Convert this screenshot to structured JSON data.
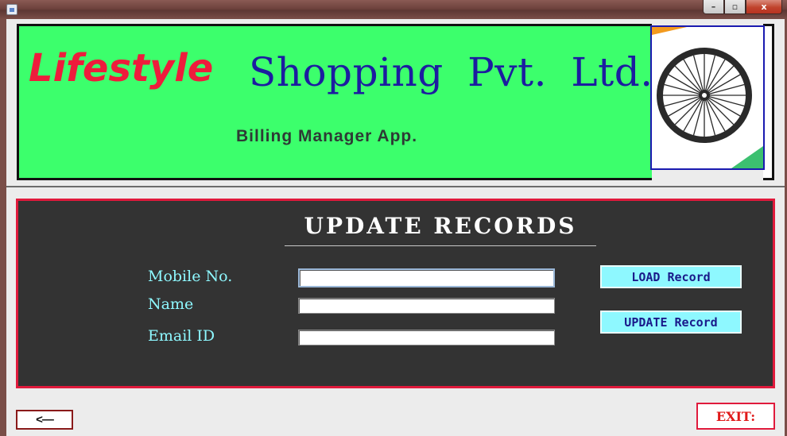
{
  "window": {
    "minimize_glyph": "–",
    "maximize_glyph": "▫",
    "close_glyph": "x"
  },
  "header": {
    "brand_word": "Lifestyle",
    "brand_rest": "Shopping Pvt. Ltd.",
    "subtitle": "Billing Manager App.",
    "logo_icon": "ashoka-chakra-icon"
  },
  "form": {
    "title": "UPDATE RECORDS",
    "fields": [
      {
        "label": "Mobile No.",
        "value": ""
      },
      {
        "label": "Name",
        "value": ""
      },
      {
        "label": "Email ID",
        "value": ""
      }
    ],
    "load_button": "LOAD Record",
    "update_button": "UPDATE Record"
  },
  "footer": {
    "back_button": "<—",
    "exit_button": "EXIT:"
  },
  "colors": {
    "banner": "#3cff6c",
    "brand_red": "#ee1c3c",
    "brand_blue": "#1c1ca0",
    "panel": "#333333",
    "panel_border": "#e01a3c",
    "label_cyan": "#8ef8ff"
  }
}
